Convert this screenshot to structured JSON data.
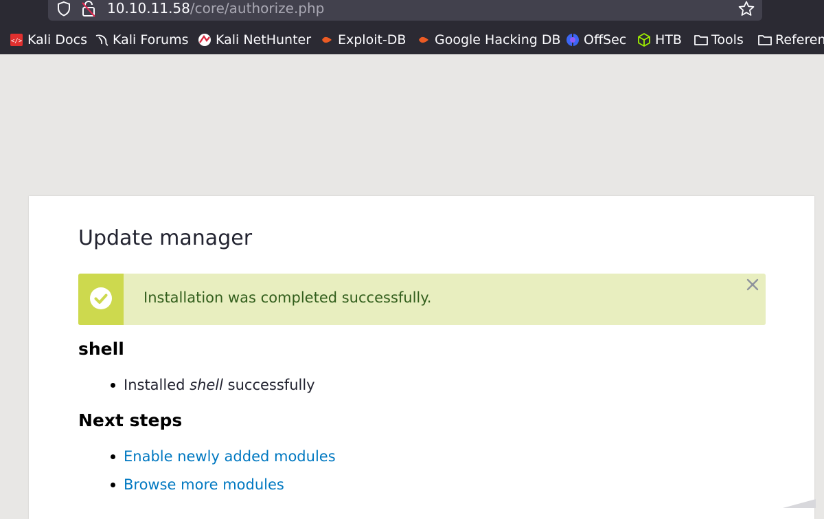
{
  "browser": {
    "url_host": "10.10.11.58",
    "url_path": "/core/authorize.php",
    "bookmarks": [
      {
        "label": "Kali Docs",
        "icon": "kali-docs-icon"
      },
      {
        "label": "Kali Forums",
        "icon": "kali-dragon-icon"
      },
      {
        "label": "Kali NetHunter",
        "icon": "nethunter-icon"
      },
      {
        "label": "Exploit-DB",
        "icon": "exploit-db-icon"
      },
      {
        "label": "Google Hacking DB",
        "icon": "exploit-db-icon"
      },
      {
        "label": "OffSec",
        "icon": "offsec-icon"
      },
      {
        "label": "HTB",
        "icon": "htb-cube-icon"
      },
      {
        "label": "Tools",
        "icon": "folder-icon"
      },
      {
        "label": "Referen",
        "icon": "folder-icon"
      }
    ]
  },
  "page": {
    "title": "Update manager",
    "status_message": "Installation was completed successfully.",
    "module": {
      "name": "shell",
      "result_prefix": "Installed ",
      "result_module": "shell",
      "result_suffix": " successfully"
    },
    "next_steps": {
      "heading": "Next steps",
      "links": [
        {
          "label": "Enable newly added modules"
        },
        {
          "label": "Browse more modules"
        }
      ]
    }
  },
  "colors": {
    "chrome_bg": "#2b2a33",
    "page_bg": "#e8e7e5",
    "status_bg": "#e8eebf",
    "status_icon_bg": "#cdd94e",
    "status_text": "#325e1c",
    "link": "#0078c1"
  }
}
